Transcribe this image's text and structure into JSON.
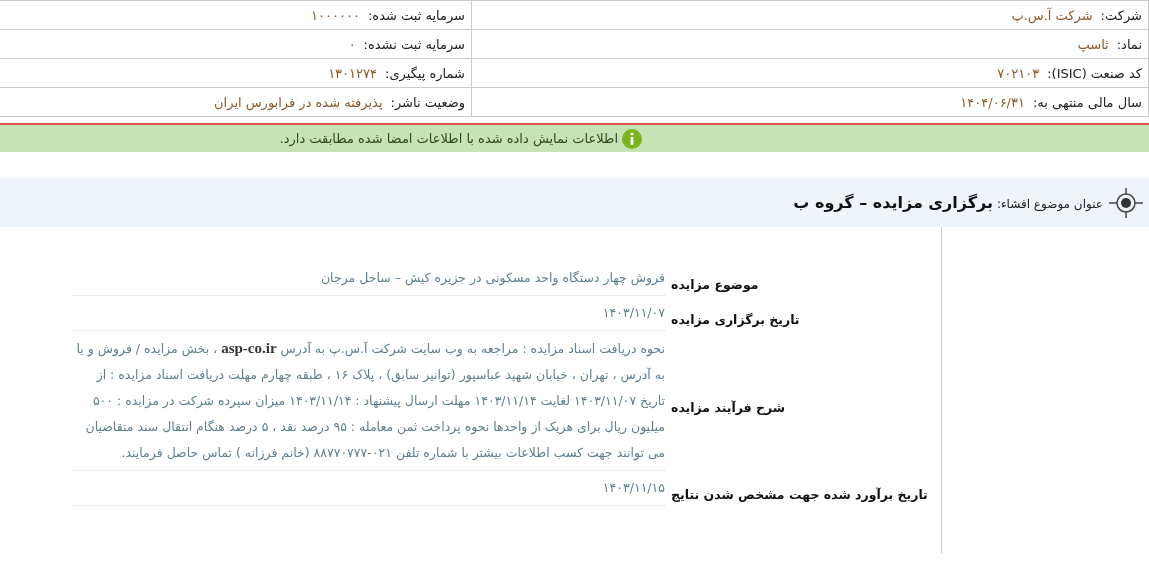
{
  "info_table": [
    {
      "cells": [
        {
          "label": "شرکت:",
          "value": "شرکت آ.س.پ"
        },
        {
          "label": "سرمایه ثبت شده:",
          "value": "۱۰۰۰۰۰۰"
        }
      ]
    },
    {
      "cells": [
        {
          "label": "نماد:",
          "value": "ثاسپ"
        },
        {
          "label": "سرمایه ثبت نشده:",
          "value": "۰"
        }
      ]
    },
    {
      "cells": [
        {
          "label": "کد صنعت (ISIC):",
          "value": "۷۰۲۱۰۳"
        },
        {
          "label": "شماره پیگیری:",
          "value": "۱۳۰۱۲۷۴"
        }
      ]
    },
    {
      "cells": [
        {
          "label": "سال مالی منتهی به:",
          "value": "۱۴۰۴/۰۶/۳۱"
        },
        {
          "label": "وضعیت ناشر:",
          "value": "پذیرفته شده در فرابورس ایران"
        }
      ]
    }
  ],
  "notice": {
    "text": "اطلاعات نمایش داده شده با اطلاعات امضا شده مطابقت دارد."
  },
  "subject": {
    "label": "عنوان موضوع افشاء:",
    "title": "برگزاری مزایده – گروه ب"
  },
  "details": [
    {
      "label": "موضوع مزایده",
      "value": "فروش چهار دستگاه واحد مسکونی در جزیره کیش – ساحل مرجان"
    },
    {
      "label": "تاریخ برگزاری مزایده",
      "value": "۱۴۰۳/۱۱/۰۷"
    },
    {
      "label": "شرح فرآیند مزایده",
      "value": "نحوه دریافت اسناد مزایده : مراجعه به وب سایت شرکت آ.س.پ به آدرس **asp-co.ir** ، بخش مزایده / فروش و یا به آدرس ، تهران ، خیابان شهید عباسپور (توانیر سابق) ، پلاک ۱۶ ، طبقه چهارم مهلت دریافت اسناد مزایده : از تاریخ ۱۴۰۳/۱۱/۰۷ لغایت ۱۴۰۳/۱۱/۱۴ مهلت ارسال پیشنهاد : ۱۴۰۳/۱۱/۱۴ میزان سپرده شرکت در مزایده : ۵۰۰ میلیون ریال برای هریک از واحدها نحوه پرداخت ثمن معامله : ۹۵ درصد نقد ، ۵ درصد هنگام انتقال سند متقاضیان می توانند جهت کسب اطلاعات بیشتر با شماره تلفن ۰۲۱-۸۸۷۷۰۷۷۷ (خانم فرزانه ) تماس حاصل فرمایند."
    },
    {
      "label": "تاریخ برآورد شده جهت مشخص شدن نتایج",
      "value": "۱۴۰۳/۱۱/۱۵"
    }
  ]
}
